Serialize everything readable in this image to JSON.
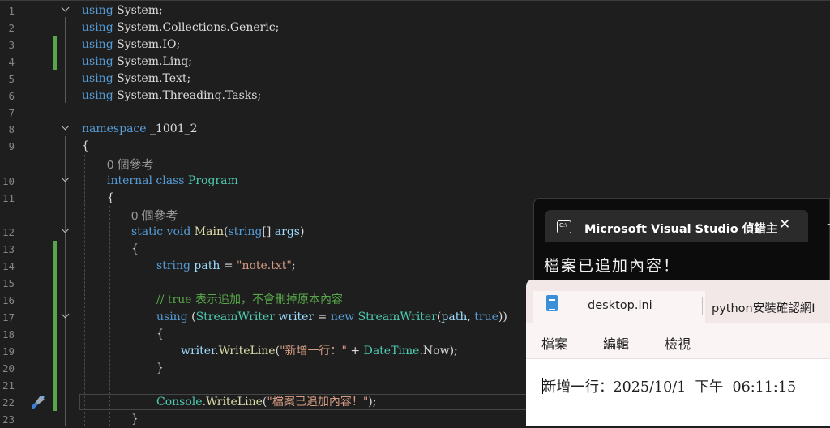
{
  "editor": {
    "lines": [
      {
        "n": "1",
        "segments": [
          [
            "kw",
            "using"
          ],
          [
            "plain",
            " System;"
          ]
        ]
      },
      {
        "n": "2",
        "segments": [
          [
            "kw",
            "using"
          ],
          [
            "plain",
            " System.Collections.Generic;"
          ]
        ]
      },
      {
        "n": "3",
        "segments": [
          [
            "kw",
            "using"
          ],
          [
            "plain",
            " System.IO;"
          ]
        ]
      },
      {
        "n": "4",
        "segments": [
          [
            "kw",
            "using"
          ],
          [
            "plain",
            " System.Linq;"
          ]
        ]
      },
      {
        "n": "5",
        "segments": [
          [
            "kw",
            "using"
          ],
          [
            "plain",
            " System.Text;"
          ]
        ]
      },
      {
        "n": "6",
        "segments": [
          [
            "kw",
            "using"
          ],
          [
            "plain",
            " System.Threading.Tasks;"
          ]
        ]
      },
      {
        "n": "7",
        "segments": []
      },
      {
        "n": "8",
        "segments": [
          [
            "kw",
            "namespace"
          ],
          [
            "plain",
            " _1001_2"
          ]
        ]
      },
      {
        "n": "9",
        "segments": [
          [
            "plain",
            "{"
          ]
        ]
      },
      {
        "n": "10",
        "segments": [
          [
            "kw",
            "internal"
          ],
          [
            "plain",
            " "
          ],
          [
            "kw",
            "class"
          ],
          [
            "plain",
            " "
          ],
          [
            "ty",
            "Program"
          ]
        ]
      },
      {
        "n": "11",
        "segments": [
          [
            "plain",
            "{"
          ]
        ]
      },
      {
        "n": "12",
        "segments": [
          [
            "kw",
            "static"
          ],
          [
            "plain",
            " "
          ],
          [
            "kw",
            "void"
          ],
          [
            "plain",
            " "
          ],
          [
            "fn",
            "Main"
          ],
          [
            "plain",
            "("
          ],
          [
            "kw",
            "string"
          ],
          [
            "plain",
            "[] "
          ],
          [
            "var",
            "args"
          ],
          [
            "plain",
            ")"
          ]
        ]
      },
      {
        "n": "13",
        "segments": [
          [
            "plain",
            "{"
          ]
        ]
      },
      {
        "n": "14",
        "segments": [
          [
            "kw",
            "string"
          ],
          [
            "plain",
            " "
          ],
          [
            "var",
            "path"
          ],
          [
            "plain",
            " = "
          ],
          [
            "str",
            "\"note.txt\""
          ],
          [
            "plain",
            ";"
          ]
        ]
      },
      {
        "n": "15",
        "segments": []
      },
      {
        "n": "16",
        "segments": [
          [
            "cm",
            "// true 表示追加，不會刪掉原本內容"
          ]
        ]
      },
      {
        "n": "17",
        "segments": [
          [
            "kw",
            "using"
          ],
          [
            "plain",
            " ("
          ],
          [
            "ty",
            "StreamWriter"
          ],
          [
            "plain",
            " "
          ],
          [
            "var",
            "writer"
          ],
          [
            "plain",
            " = "
          ],
          [
            "kw",
            "new"
          ],
          [
            "plain",
            " "
          ],
          [
            "ty",
            "StreamWriter"
          ],
          [
            "plain",
            "("
          ],
          [
            "var",
            "path"
          ],
          [
            "plain",
            ", "
          ],
          [
            "kw",
            "true"
          ],
          [
            "plain",
            "))"
          ]
        ]
      },
      {
        "n": "18",
        "segments": [
          [
            "plain",
            "{"
          ]
        ]
      },
      {
        "n": "19",
        "segments": [
          [
            "var",
            "writer"
          ],
          [
            "plain",
            "."
          ],
          [
            "fn",
            "WriteLine"
          ],
          [
            "plain",
            "("
          ],
          [
            "str",
            "\"新增一行：\""
          ],
          [
            "plain",
            " + "
          ],
          [
            "ty",
            "DateTime"
          ],
          [
            "plain",
            ".Now);"
          ]
        ]
      },
      {
        "n": "20",
        "segments": [
          [
            "plain",
            "}"
          ]
        ]
      },
      {
        "n": "21",
        "segments": []
      },
      {
        "n": "22",
        "segments": [
          [
            "ty",
            "Console"
          ],
          [
            "plain",
            "."
          ],
          [
            "fn",
            "WriteLine"
          ],
          [
            "plain",
            "("
          ],
          [
            "str",
            "\"檔案已追加內容！\""
          ],
          [
            "plain",
            ");"
          ]
        ]
      },
      {
        "n": "23",
        "segments": [
          [
            "plain",
            "}"
          ]
        ]
      }
    ],
    "codelens_class": "0 個參考",
    "codelens_main": "0 個參考"
  },
  "console_window": {
    "title": "Microsoft Visual Studio 偵錯主",
    "close": "✕",
    "new_tab": "+",
    "output": "檔案已追加內容！"
  },
  "notepad": {
    "tab_active": "desktop.ini",
    "tab_other": "python安裝確認網I",
    "menu": [
      "檔案",
      "編輯",
      "檢視"
    ],
    "content": "新增一行：2025/10/1  下午  06:11:15"
  },
  "colors": {
    "editor_bg": "#1e1e1e",
    "keyword": "#569cd6",
    "type": "#4ec9b0",
    "string": "#d69d85",
    "comment": "#57a64a",
    "change_bar": "#57a64a"
  }
}
